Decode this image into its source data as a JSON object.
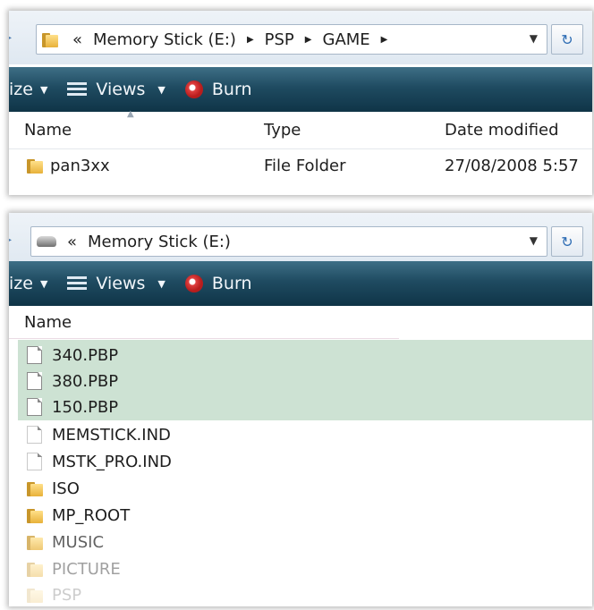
{
  "panel1": {
    "address": {
      "prefix": "«",
      "segments": [
        "Memory Stick (E:)",
        "PSP",
        "GAME"
      ]
    },
    "toolbar": {
      "organize_label": "ize",
      "views_label": "Views",
      "burn_label": "Burn"
    },
    "columns": {
      "name": "Name",
      "type": "Type",
      "date": "Date modified"
    },
    "row": {
      "name": "pan3xx",
      "type": "File Folder",
      "date": "27/08/2008 5:57"
    }
  },
  "panel2": {
    "address": {
      "prefix": "«",
      "segments": [
        "Memory Stick (E:)"
      ]
    },
    "toolbar": {
      "organize_label": "ize",
      "views_label": "Views",
      "burn_label": "Burn"
    },
    "columns": {
      "name": "Name"
    },
    "items": [
      {
        "name": "340.PBP",
        "kind": "file",
        "selected": true
      },
      {
        "name": "380.PBP",
        "kind": "file",
        "selected": true
      },
      {
        "name": "150.PBP",
        "kind": "file",
        "selected": true
      },
      {
        "name": "MEMSTICK.IND",
        "kind": "file",
        "selected": false
      },
      {
        "name": "MSTK_PRO.IND",
        "kind": "file",
        "selected": false
      },
      {
        "name": "ISO",
        "kind": "folder",
        "selected": false
      },
      {
        "name": "MP_ROOT",
        "kind": "folder",
        "selected": false
      },
      {
        "name": "MUSIC",
        "kind": "folder",
        "selected": false
      },
      {
        "name": "PICTURE",
        "kind": "folder",
        "selected": false
      },
      {
        "name": "PSP",
        "kind": "folder",
        "selected": false
      }
    ]
  },
  "icons": {
    "address_folder": "folder-icon",
    "address_drive": "drive-icon",
    "refresh": "refresh-icon",
    "views": "views-icon",
    "burn": "burn-icon"
  },
  "colors": {
    "toolbar_top": "#3e6f86",
    "toolbar_bottom": "#0f3447",
    "selection": "#cde2d3",
    "folder": "#e8b13a"
  }
}
